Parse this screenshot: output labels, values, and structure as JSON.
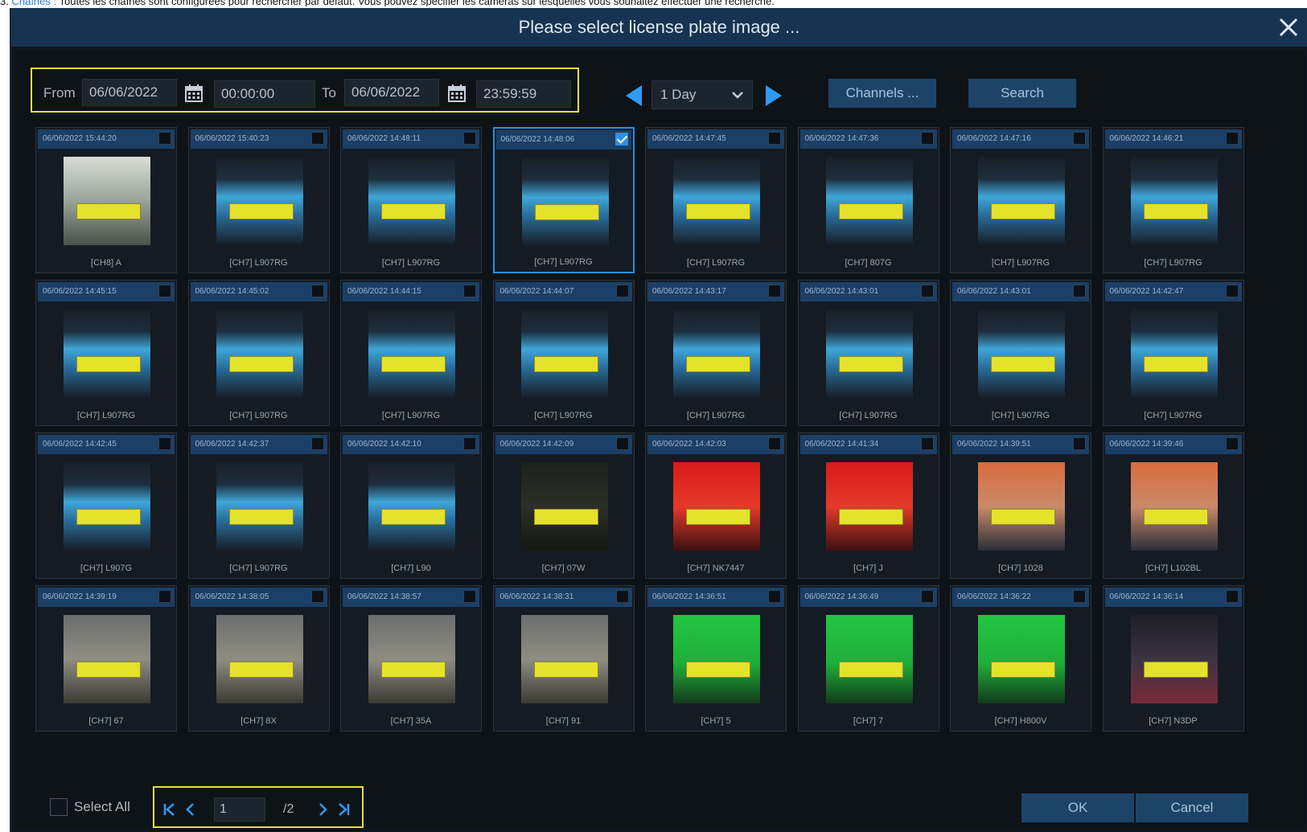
{
  "doc_text": {
    "prefix": "3. ",
    "link": "Chaînes :",
    "rest": " Toutes les chaînes sont configurées pour rechercher par défaut. Vous pouvez spécifier les caméras sur lesquelles vous souhaitez effectuer une recherche."
  },
  "dialog": {
    "title": "Please select license plate image ..."
  },
  "filter": {
    "from_label": "From",
    "from_date": "06/06/2022",
    "from_time": "00:00:00",
    "to_label": "To",
    "to_date": "06/06/2022",
    "to_time": "23:59:59",
    "range": "1 Day",
    "channels_label": "Channels ...",
    "search_label": "Search"
  },
  "colors": {
    "accent": "#2a8fe0",
    "highlight": "#e7e13a",
    "titlebar": "#163451",
    "button": "#1d4468"
  },
  "images": [
    {
      "time": "06/06/2022 15:44:20",
      "caption": "[CH8] A",
      "checked": false,
      "scene": "white"
    },
    {
      "time": "06/06/2022 15:40:23",
      "caption": "[CH7] L907RG",
      "checked": false,
      "scene": "car"
    },
    {
      "time": "06/06/2022 14:48:11",
      "caption": "[CH7] L907RG",
      "checked": false,
      "scene": "car"
    },
    {
      "time": "06/06/2022 14:48:06",
      "caption": "[CH7] L907RG",
      "checked": true,
      "scene": "car"
    },
    {
      "time": "06/06/2022 14:47:45",
      "caption": "[CH7] L907RG",
      "checked": false,
      "scene": "car"
    },
    {
      "time": "06/06/2022 14:47:36",
      "caption": "[CH7] 807G",
      "checked": false,
      "scene": "car"
    },
    {
      "time": "06/06/2022 14:47:16",
      "caption": "[CH7] L907RG",
      "checked": false,
      "scene": "car"
    },
    {
      "time": "06/06/2022 14:46:21",
      "caption": "[CH7] L907RG",
      "checked": false,
      "scene": "car"
    },
    {
      "time": "06/06/2022 14:45:15",
      "caption": "[CH7] L907RG",
      "checked": false,
      "scene": "car"
    },
    {
      "time": "06/06/2022 14:45:02",
      "caption": "[CH7] L907RG",
      "checked": false,
      "scene": "car"
    },
    {
      "time": "06/06/2022 14:44:15",
      "caption": "[CH7] L907RG",
      "checked": false,
      "scene": "car"
    },
    {
      "time": "06/06/2022 14:44:07",
      "caption": "[CH7] L907RG",
      "checked": false,
      "scene": "car"
    },
    {
      "time": "06/06/2022 14:43:17",
      "caption": "[CH7] L907RG",
      "checked": false,
      "scene": "car"
    },
    {
      "time": "06/06/2022 14:43:01",
      "caption": "[CH7] L907RG",
      "checked": false,
      "scene": "car"
    },
    {
      "time": "06/06/2022 14:43:01",
      "caption": "[CH7] L907RG",
      "checked": false,
      "scene": "car"
    },
    {
      "time": "06/06/2022 14:42:47",
      "caption": "[CH7] L907RG",
      "checked": false,
      "scene": "car"
    },
    {
      "time": "06/06/2022 14:42:45",
      "caption": "[CH7] L907G",
      "checked": false,
      "scene": "car"
    },
    {
      "time": "06/06/2022 14:42:37",
      "caption": "[CH7] L907RG",
      "checked": false,
      "scene": "car"
    },
    {
      "time": "06/06/2022 14:42:10",
      "caption": "[CH7] L90",
      "checked": false,
      "scene": "car"
    },
    {
      "time": "06/06/2022 14:42:09",
      "caption": "[CH7] 07W",
      "checked": false,
      "scene": "dark"
    },
    {
      "time": "06/06/2022 14:42:03",
      "caption": "[CH7] NK7447",
      "checked": false,
      "scene": "red"
    },
    {
      "time": "06/06/2022 14:41:34",
      "caption": "[CH7] J",
      "checked": false,
      "scene": "red"
    },
    {
      "time": "06/06/2022 14:39:51",
      "caption": "[CH7] 1028",
      "checked": false,
      "scene": "orange"
    },
    {
      "time": "06/06/2022 14:39:46",
      "caption": "[CH7] L102BL",
      "checked": false,
      "scene": "orange"
    },
    {
      "time": "06/06/2022 14:39:19",
      "caption": "[CH7] 67",
      "checked": false,
      "scene": "grey"
    },
    {
      "time": "06/06/2022 14:38:05",
      "caption": "[CH7] 8X",
      "checked": false,
      "scene": "grey"
    },
    {
      "time": "06/06/2022 14:38:57",
      "caption": "[CH7] 35A",
      "checked": false,
      "scene": "grey"
    },
    {
      "time": "06/06/2022 14:38:31",
      "caption": "[CH7] 91",
      "checked": false,
      "scene": "grey"
    },
    {
      "time": "06/06/2022 14:36:51",
      "caption": "[CH7] 5",
      "checked": false,
      "scene": "green"
    },
    {
      "time": "06/06/2022 14:36:49",
      "caption": "[CH7] 7",
      "checked": false,
      "scene": "green"
    },
    {
      "time": "06/06/2022 14:36:22",
      "caption": "[CH7] H800V",
      "checked": false,
      "scene": "green"
    },
    {
      "time": "06/06/2022 14:36:14",
      "caption": "[CH7] N3DP",
      "checked": false,
      "scene": "purple"
    }
  ],
  "footer": {
    "select_all_label": "Select All",
    "page_current": "1",
    "page_total": "/2",
    "ok_label": "OK",
    "cancel_label": "Cancel"
  }
}
